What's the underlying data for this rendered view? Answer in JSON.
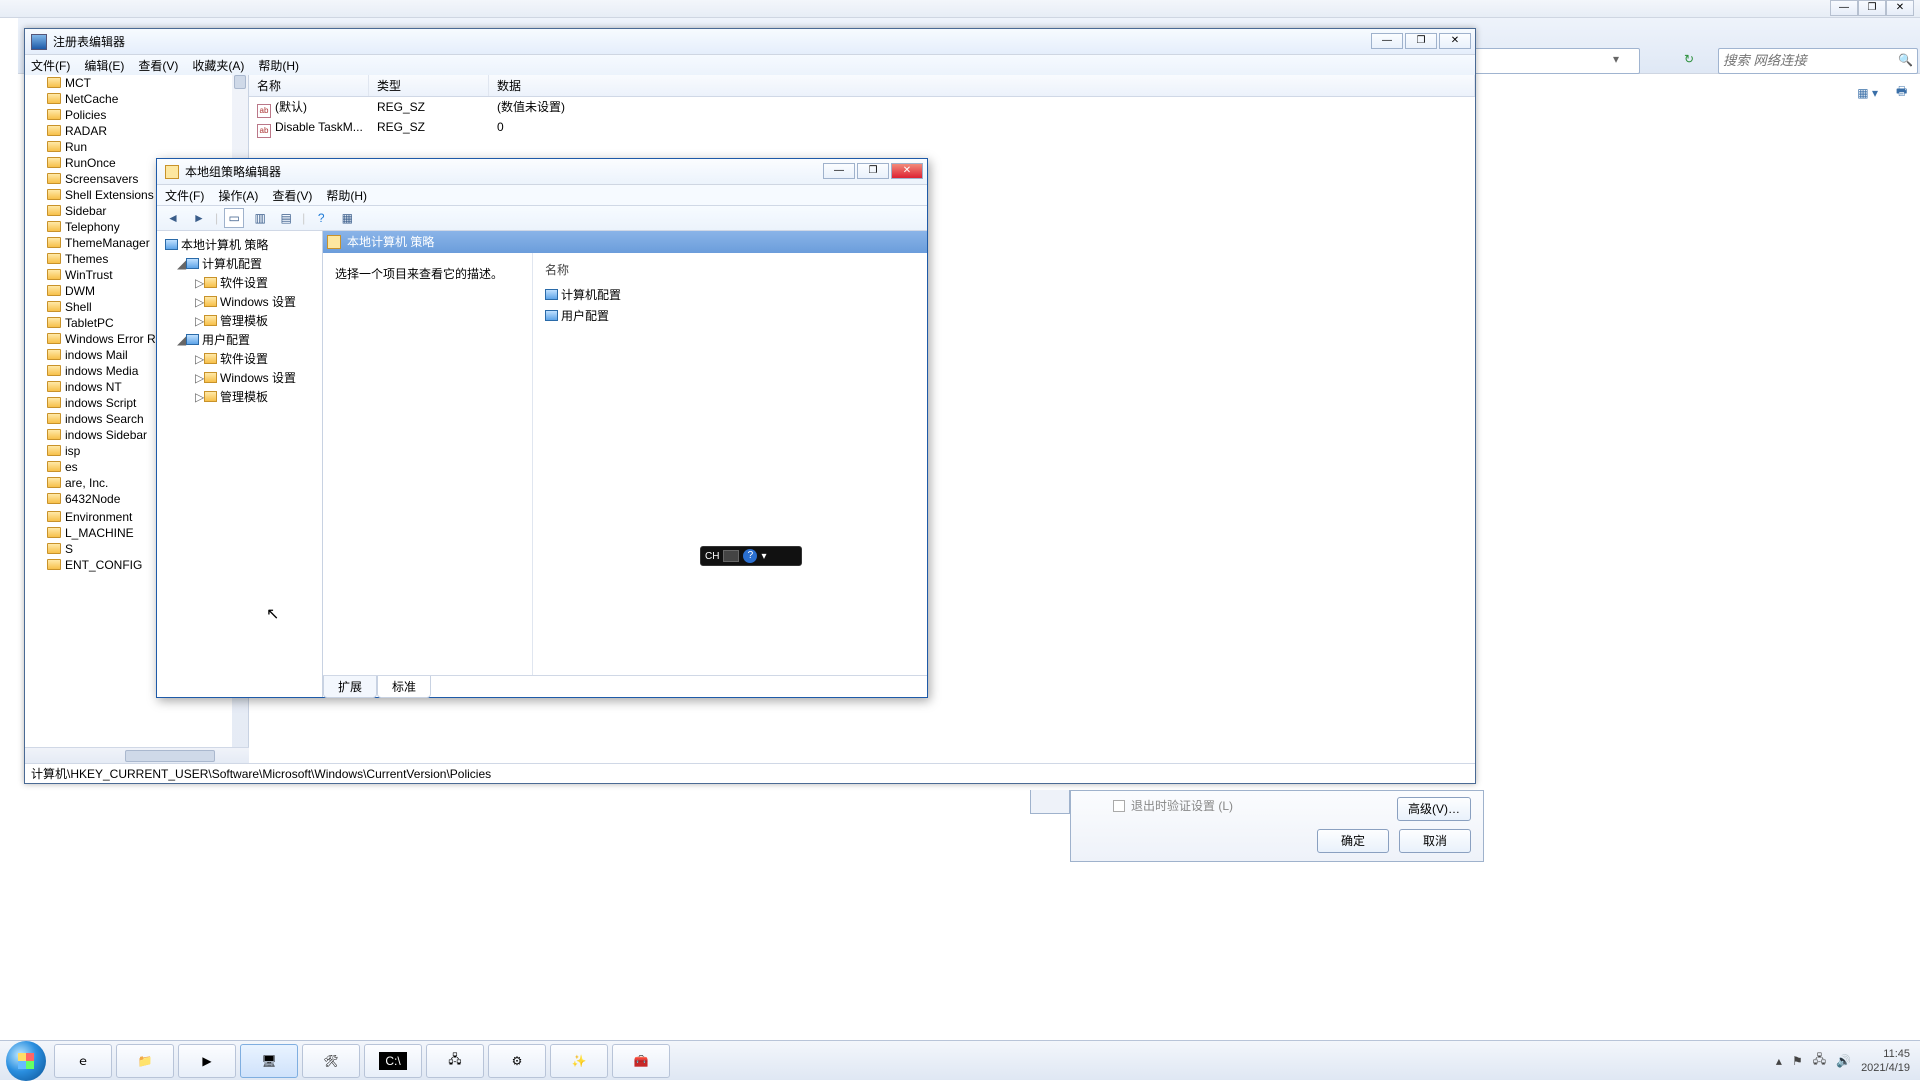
{
  "ie": {
    "search_placeholder": "搜索 网络连接",
    "refresh_icon": "↻",
    "ctrl_min": "—",
    "ctrl_rest": "❐",
    "ctrl_close": "✕",
    "tool_view": "▦ ▾",
    "tool_print": "🖶",
    "tool_help": "?"
  },
  "regedit": {
    "title": "注册表编辑器",
    "menu": [
      "文件(F)",
      "编辑(E)",
      "查看(V)",
      "收藏夹(A)",
      "帮助(H)"
    ],
    "cols": {
      "name": "名称",
      "type": "类型",
      "data": "数据"
    },
    "rows": [
      {
        "name": "(默认)",
        "type": "REG_SZ",
        "data": "(数值未设置)"
      },
      {
        "name": "Disable TaskM...",
        "type": "REG_SZ",
        "data": "0"
      }
    ],
    "tree": [
      "MCT",
      "NetCache",
      "Policies",
      "RADAR",
      "Run",
      "RunOnce",
      "Screensavers",
      "Shell Extensions",
      "Sidebar",
      "Telephony",
      "ThemeManager",
      "Themes",
      "WinTrust",
      "DWM",
      "Shell",
      "TabletPC",
      "Windows Error Rep",
      "indows Mail",
      "indows Media",
      "indows NT",
      "indows Script",
      "indows Search",
      "indows Sidebar",
      "isp",
      "es",
      "are, Inc.",
      "6432Node",
      "",
      "Environment",
      "L_MACHINE",
      "S",
      "ENT_CONFIG"
    ],
    "status": "计算机\\HKEY_CURRENT_USER\\Software\\Microsoft\\Windows\\CurrentVersion\\Policies",
    "ctrl_min": "—",
    "ctrl_rest": "❐",
    "ctrl_close": "✕"
  },
  "gpedit": {
    "title": "本地组策略编辑器",
    "menu": [
      "文件(F)",
      "操作(A)",
      "查看(V)",
      "帮助(H)"
    ],
    "toolbar": [
      "◄",
      "►",
      "|",
      "▭",
      "▥",
      "▤",
      "|",
      "?",
      "▦"
    ],
    "root": "本地计算机 策略",
    "computer": "计算机配置",
    "user": "用户配置",
    "sub": [
      "软件设置",
      "Windows 设置",
      "管理模板"
    ],
    "panel_head": "本地计算机 策略",
    "panel_hint": "选择一个项目来查看它的描述。",
    "name_col": "名称",
    "items": [
      "计算机配置",
      "用户配置"
    ],
    "tabs": [
      "扩展",
      "标准"
    ],
    "ctrl_min": "—",
    "ctrl_rest": "❐",
    "ctrl_close": "✕"
  },
  "ime": {
    "lang": "CH",
    "q": "?"
  },
  "opt": {
    "chk": "退出时验证设置 (L)",
    "adv": "高级(V)…",
    "ok": "确定",
    "cancel": "取消"
  },
  "tray": {
    "time": "11:45",
    "date": "2021/4/19"
  }
}
